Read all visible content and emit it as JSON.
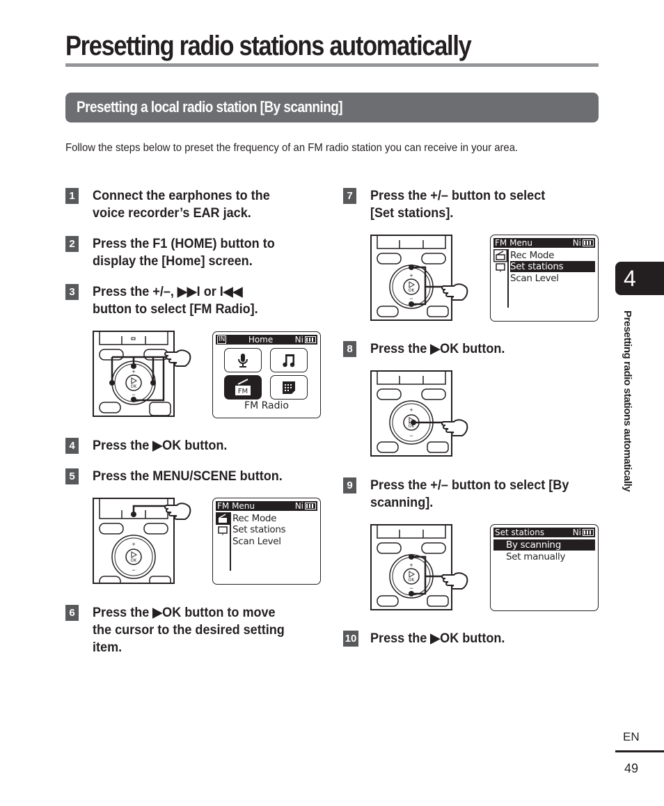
{
  "page": {
    "title": "Presetting radio stations automatically",
    "section_title": "Presetting a local radio station [By scanning]",
    "intro": "Follow the steps below to preset the frequency of an FM radio station you can receive in your area.",
    "chapter_number": "4",
    "chapter_label": "Presetting radio stations automatically",
    "language": "EN",
    "page_number": "49"
  },
  "steps": [
    {
      "num": "1",
      "lines": [
        "Connect the earphones to the",
        "voice recorder’s EAR jack."
      ]
    },
    {
      "num": "2",
      "lines": [
        "Press the F1 (HOME) button to",
        "display the [Home] screen."
      ]
    },
    {
      "num": "3",
      "lines": [
        "Press the +/–, ▶▶I or I◀◀",
        "button to select [FM Radio]."
      ]
    },
    {
      "num": "4",
      "lines": [
        "Press the ▶OK button."
      ]
    },
    {
      "num": "5",
      "lines": [
        "Press the MENU/SCENE button."
      ]
    },
    {
      "num": "6",
      "lines": [
        "Press the ▶OK button to move",
        "the cursor to the desired setting",
        "item."
      ]
    },
    {
      "num": "7",
      "lines": [
        "Press the +/– button to select",
        "[Set stations]."
      ]
    },
    {
      "num": "8",
      "lines": [
        "Press the ▶OK button."
      ]
    },
    {
      "num": "9",
      "lines": [
        "Press the +/– button to select [By",
        "scanning]."
      ]
    },
    {
      "num": "10",
      "lines": [
        "Press the ▶OK button."
      ]
    }
  ],
  "screens": {
    "home": {
      "header_left": "IN",
      "header_title": "Home",
      "header_right": "Ni",
      "tiles": [
        "microphone-icon",
        "music-note-icon",
        "fm-radio-icon",
        "calendar-icon"
      ],
      "selected_tile": "fm-radio-icon",
      "fm_badge": "FM",
      "caption": "FM Radio"
    },
    "fm_menu_1": {
      "header_title": "FM Menu",
      "header_right": "Ni",
      "items": [
        "Rec Mode",
        "Set stations",
        "Scan Level"
      ],
      "selected_index": -1
    },
    "fm_menu_2": {
      "header_title": "FM Menu",
      "header_right": "Ni",
      "items": [
        "Rec Mode",
        "Set stations",
        "Scan Level"
      ],
      "selected_index": 1
    },
    "set_stations": {
      "header_title": "Set stations",
      "header_right": "Ni",
      "items": [
        "By scanning",
        "Set manually"
      ],
      "selected_index": 0
    }
  },
  "device": {
    "plus_label": "+",
    "minus_label": "−",
    "ok_label": "OK"
  }
}
